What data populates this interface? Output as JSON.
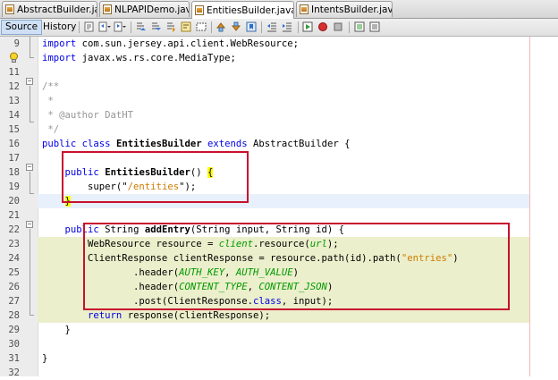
{
  "tabs": [
    {
      "label": "AbstractBuilder.java",
      "close": "×",
      "active": false
    },
    {
      "label": "NLPAPIDemo.java",
      "close": "×",
      "active": false
    },
    {
      "label": "EntitiesBuilder.java",
      "close": "×",
      "active": true
    },
    {
      "label": "IntentsBuilder.java",
      "close": "×",
      "active": false
    }
  ],
  "toolbar": {
    "source_label": "Source",
    "history_label": "History"
  },
  "editor": {
    "lines": [
      {
        "n": "9",
        "segs": [
          {
            "t": "import",
            "c": "kw"
          },
          {
            "t": " com.sun.jersey.api.client.WebResource;"
          }
        ]
      },
      {
        "n": "",
        "segs": [
          {
            "t": "import",
            "c": "kw"
          },
          {
            "t": " javax.ws.rs.core.MediaType;"
          }
        ]
      },
      {
        "n": "11",
        "segs": []
      },
      {
        "n": "12",
        "segs": [
          {
            "t": "/**",
            "c": "cm"
          }
        ]
      },
      {
        "n": "13",
        "segs": [
          {
            "t": " *",
            "c": "cm"
          }
        ]
      },
      {
        "n": "14",
        "segs": [
          {
            "t": " * @author DatHT",
            "c": "cm"
          }
        ]
      },
      {
        "n": "15",
        "segs": [
          {
            "t": " */",
            "c": "cm"
          }
        ]
      },
      {
        "n": "16",
        "segs": [
          {
            "t": "public class",
            "c": "kw"
          },
          {
            "t": " "
          },
          {
            "t": "EntitiesBuilder",
            "c": "mth"
          },
          {
            "t": " "
          },
          {
            "t": "extends",
            "c": "kw"
          },
          {
            "t": " AbstractBuilder {"
          }
        ]
      },
      {
        "n": "17",
        "segs": []
      },
      {
        "n": "18",
        "segs": [
          {
            "t": "    "
          },
          {
            "t": "public",
            "c": "kw"
          },
          {
            "t": " "
          },
          {
            "t": "EntitiesBuilder",
            "c": "mth"
          },
          {
            "t": "() "
          },
          {
            "t": "{",
            "c": "br"
          }
        ]
      },
      {
        "n": "19",
        "segs": [
          {
            "t": "        super(\""
          },
          {
            "t": "/entities",
            "c": "str"
          },
          {
            "t": "\");"
          }
        ]
      },
      {
        "n": "20",
        "segs": [
          {
            "t": "    "
          },
          {
            "t": "}",
            "c": "br"
          }
        ]
      },
      {
        "n": "21",
        "segs": []
      },
      {
        "n": "22",
        "segs": [
          {
            "t": "    "
          },
          {
            "t": "public",
            "c": "kw"
          },
          {
            "t": " String "
          },
          {
            "t": "addEntry",
            "c": "mth"
          },
          {
            "t": "(String input, String id) {"
          }
        ]
      },
      {
        "n": "23",
        "segs": [
          {
            "t": "        WebResource resource = "
          },
          {
            "t": "client",
            "c": "it"
          },
          {
            "t": ".resource("
          },
          {
            "t": "url",
            "c": "it"
          },
          {
            "t": ");"
          }
        ]
      },
      {
        "n": "24",
        "segs": [
          {
            "t": "        ClientResponse clientResponse = resource.path(id).path("
          },
          {
            "t": "\"entries\"",
            "c": "str"
          },
          {
            "t": ")"
          }
        ]
      },
      {
        "n": "25",
        "segs": [
          {
            "t": "                .header("
          },
          {
            "t": "AUTH_KEY",
            "c": "it"
          },
          {
            "t": ", "
          },
          {
            "t": "AUTH_VALUE",
            "c": "it"
          },
          {
            "t": ")"
          }
        ]
      },
      {
        "n": "26",
        "segs": [
          {
            "t": "                .header("
          },
          {
            "t": "CONTENT_TYPE",
            "c": "it"
          },
          {
            "t": ", "
          },
          {
            "t": "CONTENT_JSON",
            "c": "it"
          },
          {
            "t": ")"
          }
        ]
      },
      {
        "n": "27",
        "segs": [
          {
            "t": "                .post(ClientResponse."
          },
          {
            "t": "class",
            "c": "kw"
          },
          {
            "t": ", input);"
          }
        ]
      },
      {
        "n": "28",
        "segs": [
          {
            "t": "        "
          },
          {
            "t": "return",
            "c": "kw"
          },
          {
            "t": " response(clientResponse);"
          }
        ]
      },
      {
        "n": "29",
        "segs": [
          {
            "t": "    }"
          }
        ]
      },
      {
        "n": "30",
        "segs": []
      },
      {
        "n": "31",
        "segs": [
          {
            "t": "}"
          }
        ]
      },
      {
        "n": "32",
        "segs": []
      }
    ]
  }
}
